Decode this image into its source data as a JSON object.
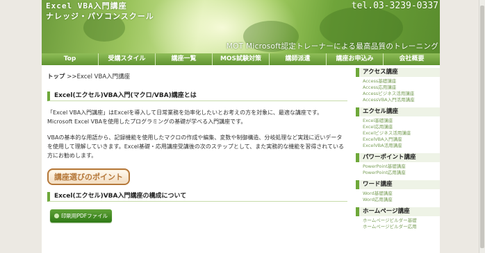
{
  "header": {
    "title_line1": "Excel VBA入門講座",
    "title_line2": "ナレッジ・パソコンスクール",
    "tel": "tel.03-3239-0337",
    "tagline": "MOT Microsoft認定トレーナーによる最高品質のトレーニング"
  },
  "nav": [
    "Top",
    "受講スタイル",
    "講座一覧",
    "MOS試験対策",
    "講師派遣",
    "講座お申込み",
    "会社概要"
  ],
  "breadcrumb": {
    "home": "トップ",
    "current": ">>Excel VBA入門講座"
  },
  "main": {
    "heading1": "Excel(エクセル)VBA入門(マクロ/VBA)講座とは",
    "para1": "「Excel VBA入門講座」はExcelを導入して日常業務を効率化したいとお考えの方を対象に、最適な講座です。Microsoft Excel VBAを使用したプログラミングの基礎が学べる入門講座です。",
    "para2": "VBAの基本的な用語から、記録機能を使用したマクロの作成や編集、変数や制御構造、分岐処理など実践に近いデータを使用して理解していきます。Excel基礎・応用講座受講後の次のステップとして、また実務的な機能を習得されている方にお勧めします。",
    "point_button": "講座選びのポイント",
    "heading2": "Excel(エクセル)VBA入門講座の構成について",
    "pdf_button": "印刷用PDFファイル"
  },
  "sidebar": [
    {
      "title": "アクセス講座",
      "links": [
        "Access基礎講座",
        "Access応用講座",
        "Accessビジネス活用講座",
        "AccessVBA入門活用講座"
      ]
    },
    {
      "title": "エクセル講座",
      "links": [
        "Excel基礎講座",
        "Excel応用講座",
        "Excelビジネス活用講座",
        "ExcelVBA入門講座",
        "ExcelVBA活用講座"
      ]
    },
    {
      "title": "パワーポイント講座",
      "links": [
        "PowerPoint基礎講座",
        "PowerPoint応用講座"
      ]
    },
    {
      "title": "ワード講座",
      "links": [
        "Word基礎講座",
        "Word応用講座"
      ]
    },
    {
      "title": "ホームページ講座",
      "links": [
        "ホームページビルダー基礎",
        "ホームページビルダー応用"
      ]
    }
  ],
  "colors": {
    "accent_green": "#6ea83a",
    "nav_green": "#5f9330",
    "link_green": "#7a9f58",
    "point_brown": "#b5783a"
  }
}
